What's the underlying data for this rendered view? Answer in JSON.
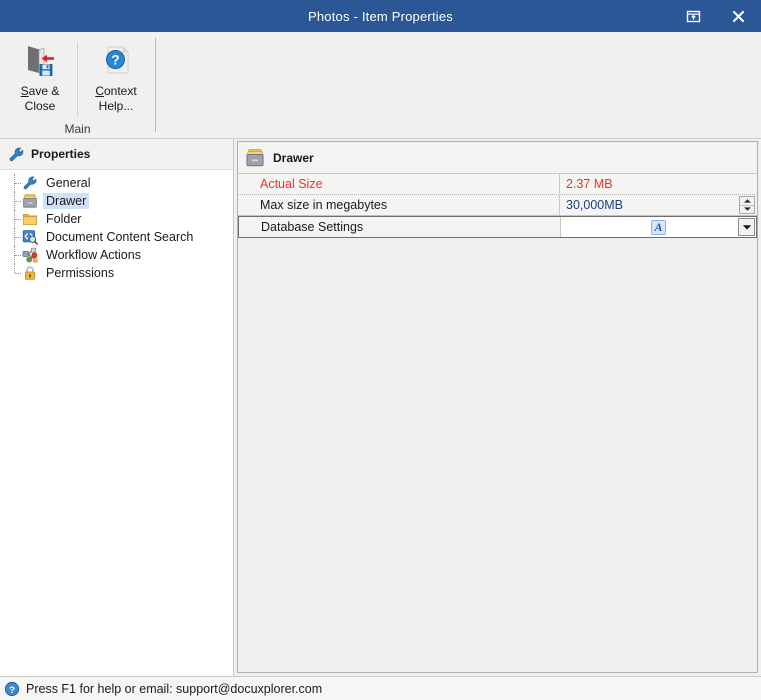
{
  "window": {
    "title": "Photos - Item Properties",
    "buttons": [
      {
        "name": "restore-up",
        "tooltip": "Restore"
      },
      {
        "name": "close",
        "tooltip": "Close"
      }
    ]
  },
  "ribbon": {
    "group_title": "Main",
    "buttons": [
      {
        "id": "save-close",
        "line1": "Save &",
        "line2": "Close",
        "icon": "door-save-icon"
      },
      {
        "id": "context-help",
        "line1": "Context",
        "line2": "Help...",
        "icon": "help-document-icon"
      }
    ]
  },
  "sidebar": {
    "header": "Properties",
    "header_icon": "wrench-icon",
    "items": [
      {
        "label": "General",
        "icon": "wrench-icon",
        "selected": false
      },
      {
        "label": "Drawer",
        "icon": "drawer-icon",
        "selected": true
      },
      {
        "label": "Folder",
        "icon": "folder-icon",
        "selected": false
      },
      {
        "label": "Document Content Search",
        "icon": "content-search-icon",
        "selected": false
      },
      {
        "label": "Workflow Actions",
        "icon": "workflow-icon",
        "selected": false
      },
      {
        "label": "Permissions",
        "icon": "lock-icon",
        "selected": false
      }
    ]
  },
  "properties": {
    "header": "Drawer",
    "header_icon": "drawer-icon",
    "rows": [
      {
        "name": "Actual Size",
        "value": "2.37 MB",
        "name_color": "#e8362a",
        "value_color": "#e8362a",
        "editor": "none",
        "readonly": true
      },
      {
        "name": "Max size in megabytes",
        "value": "30,000MB",
        "name_color": "#1a1a1a",
        "value_color": "#1f3f86",
        "editor": "spinner",
        "readonly": false
      },
      {
        "name": "Database Settings",
        "value": "",
        "name_color": "#1a1a1a",
        "value_color": "#1a1a1a",
        "editor": "dropdown",
        "editor_badge": "A",
        "readonly": false,
        "editing": true
      }
    ]
  },
  "statusbar": {
    "icon": "help-circle-icon",
    "text": "Press F1 for help or email: support@docuxplorer.com"
  },
  "colors": {
    "titlebar": "#2b5797",
    "accent_red": "#e8362a",
    "accent_blue": "#1f3f86",
    "selection": "#cde2f7",
    "ribbon_bg": "#f0f0ef"
  }
}
